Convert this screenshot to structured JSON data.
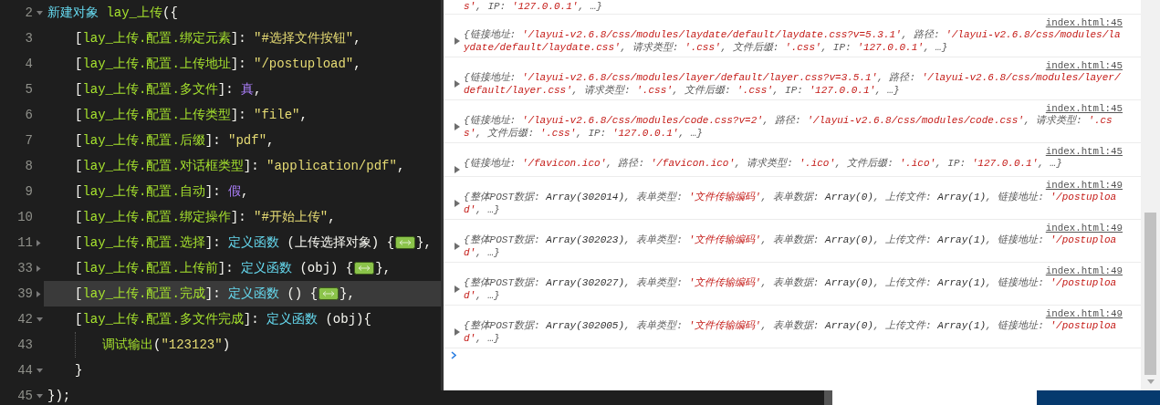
{
  "editor": {
    "lines": [
      {
        "number": "2",
        "folded": false,
        "current": false,
        "tokens": [
          {
            "kind": "keyword",
            "text": "新建对象 "
          },
          {
            "kind": "name",
            "text": "lay_上传"
          },
          {
            "kind": "plain",
            "text": "({"
          }
        ],
        "children": [
          {
            "number": "3",
            "current": false,
            "tokens": [
              {
                "kind": "plain",
                "text": "["
              },
              {
                "kind": "name",
                "text": "lay_上传.配置.绑定元素"
              },
              {
                "kind": "plain",
                "text": "]: "
              },
              {
                "kind": "string",
                "text": "\"#选择文件按钮\""
              },
              {
                "kind": "plain",
                "text": ","
              }
            ]
          },
          {
            "number": "4",
            "current": false,
            "tokens": [
              {
                "kind": "plain",
                "text": "["
              },
              {
                "kind": "name",
                "text": "lay_上传.配置.上传地址"
              },
              {
                "kind": "plain",
                "text": "]: "
              },
              {
                "kind": "string",
                "text": "\"/postupload\""
              },
              {
                "kind": "plain",
                "text": ","
              }
            ]
          },
          {
            "number": "5",
            "current": false,
            "tokens": [
              {
                "kind": "plain",
                "text": "["
              },
              {
                "kind": "name",
                "text": "lay_上传.配置.多文件"
              },
              {
                "kind": "plain",
                "text": "]: "
              },
              {
                "kind": "constant",
                "text": "真"
              },
              {
                "kind": "plain",
                "text": ","
              }
            ]
          },
          {
            "number": "6",
            "current": false,
            "tokens": [
              {
                "kind": "plain",
                "text": "["
              },
              {
                "kind": "name",
                "text": "lay_上传.配置.上传类型"
              },
              {
                "kind": "plain",
                "text": "]: "
              },
              {
                "kind": "string",
                "text": "\"file\""
              },
              {
                "kind": "plain",
                "text": ","
              }
            ]
          },
          {
            "number": "7",
            "current": false,
            "tokens": [
              {
                "kind": "plain",
                "text": "["
              },
              {
                "kind": "name",
                "text": "lay_上传.配置.后缀"
              },
              {
                "kind": "plain",
                "text": "]: "
              },
              {
                "kind": "string",
                "text": "\"pdf\""
              },
              {
                "kind": "plain",
                "text": ","
              }
            ]
          },
          {
            "number": "8",
            "current": false,
            "tokens": [
              {
                "kind": "plain",
                "text": "["
              },
              {
                "kind": "name",
                "text": "lay_上传.配置.对话框类型"
              },
              {
                "kind": "plain",
                "text": "]: "
              },
              {
                "kind": "string",
                "text": "\"application/pdf\""
              },
              {
                "kind": "plain",
                "text": ","
              }
            ]
          },
          {
            "number": "9",
            "current": false,
            "tokens": [
              {
                "kind": "plain",
                "text": "["
              },
              {
                "kind": "name",
                "text": "lay_上传.配置.自动"
              },
              {
                "kind": "plain",
                "text": "]: "
              },
              {
                "kind": "constant",
                "text": "假"
              },
              {
                "kind": "plain",
                "text": ","
              }
            ]
          },
          {
            "number": "10",
            "current": false,
            "tokens": [
              {
                "kind": "plain",
                "text": "["
              },
              {
                "kind": "name",
                "text": "lay_上传.配置.绑定操作"
              },
              {
                "kind": "plain",
                "text": "]: "
              },
              {
                "kind": "string",
                "text": "\"#开始上传\""
              },
              {
                "kind": "plain",
                "text": ","
              }
            ]
          },
          {
            "number": "11",
            "folded": true,
            "current": false,
            "tokens": [
              {
                "kind": "plain",
                "text": "["
              },
              {
                "kind": "name",
                "text": "lay_上传.配置.选择"
              },
              {
                "kind": "plain",
                "text": "]: "
              },
              {
                "kind": "keyword",
                "text": "定义函数"
              },
              {
                "kind": "plain",
                "text": " (上传选择对象) {"
              },
              {
                "kind": "folded"
              },
              {
                "kind": "plain",
                "text": "},"
              }
            ]
          },
          {
            "number": "33",
            "folded": true,
            "current": false,
            "tokens": [
              {
                "kind": "plain",
                "text": "["
              },
              {
                "kind": "name",
                "text": "lay_上传.配置.上传前"
              },
              {
                "kind": "plain",
                "text": "]: "
              },
              {
                "kind": "keyword",
                "text": "定义函数"
              },
              {
                "kind": "plain",
                "text": " (obj) {"
              },
              {
                "kind": "folded"
              },
              {
                "kind": "plain",
                "text": "},"
              }
            ]
          },
          {
            "number": "39",
            "folded": true,
            "current": true,
            "tokens": [
              {
                "kind": "plain",
                "text": "["
              },
              {
                "kind": "name",
                "text": "lay_上传.配置.完成"
              },
              {
                "kind": "plain",
                "text": "]: "
              },
              {
                "kind": "keyword",
                "text": "定义函数"
              },
              {
                "kind": "plain",
                "text": " () {"
              },
              {
                "kind": "folded"
              },
              {
                "kind": "plain",
                "text": "},"
              }
            ]
          },
          {
            "number": "42",
            "folded": false,
            "current": false,
            "tokens": [
              {
                "kind": "plain",
                "text": "["
              },
              {
                "kind": "name",
                "text": "lay_上传.配置.多文件完成"
              },
              {
                "kind": "plain",
                "text": "]: "
              },
              {
                "kind": "keyword",
                "text": "定义函数"
              },
              {
                "kind": "plain",
                "text": " (obj){"
              }
            ],
            "children": [
              {
                "number": "43",
                "current": false,
                "tokens": [
                  {
                    "kind": "name",
                    "text": "调试输出"
                  },
                  {
                    "kind": "plain",
                    "text": "("
                  },
                  {
                    "kind": "string",
                    "text": "\"123123\""
                  },
                  {
                    "kind": "plain",
                    "text": ")"
                  }
                ]
              }
            ]
          },
          {
            "number": "44",
            "folded": false,
            "current": false,
            "tokens": [
              {
                "kind": "plain",
                "text": "}"
              }
            ]
          }
        ]
      },
      {
        "number": "45",
        "folded": false,
        "current": false,
        "tokens": [
          {
            "kind": "plain",
            "text": "});"
          }
        ]
      }
    ]
  },
  "console": {
    "entries": [
      {
        "segments": [
          {
            "kind": "string",
            "text": "s'"
          },
          {
            "kind": "key",
            "text": ", IP: "
          },
          {
            "kind": "string",
            "text": "'127.0.0.1'"
          },
          {
            "kind": "key",
            "text": ", …}"
          }
        ]
      },
      {
        "source": "index.html:45",
        "segments": [
          {
            "kind": "key",
            "text": "{链接地址: "
          },
          {
            "kind": "string",
            "text": "'/layui-v2.6.8/css/modules/laydate/default/laydate.css?v=5.3.1'"
          },
          {
            "kind": "key",
            "text": ", 路径: "
          },
          {
            "kind": "string",
            "text": "'/layui-v2.6.8/css/modules/laydate/default/laydate.css'"
          },
          {
            "kind": "key",
            "text": ", 请求类型: "
          },
          {
            "kind": "string",
            "text": "'.css'"
          },
          {
            "kind": "key",
            "text": ", 文件后缀: "
          },
          {
            "kind": "string",
            "text": "'.css'"
          },
          {
            "kind": "key",
            "text": ", IP: "
          },
          {
            "kind": "string",
            "text": "'127.0.0.1'"
          },
          {
            "kind": "key",
            "text": ", …}"
          }
        ]
      },
      {
        "source": "index.html:45",
        "segments": [
          {
            "kind": "key",
            "text": "{链接地址: "
          },
          {
            "kind": "string",
            "text": "'/layui-v2.6.8/css/modules/layer/default/layer.css?v=3.5.1'"
          },
          {
            "kind": "key",
            "text": ", 路径: "
          },
          {
            "kind": "string",
            "text": "'/layui-v2.6.8/css/modules/layer/default/layer.css'"
          },
          {
            "kind": "key",
            "text": ", 请求类型: "
          },
          {
            "kind": "string",
            "text": "'.css'"
          },
          {
            "kind": "key",
            "text": ", 文件后缀: "
          },
          {
            "kind": "string",
            "text": "'.css'"
          },
          {
            "kind": "key",
            "text": ", IP: "
          },
          {
            "kind": "string",
            "text": "'127.0.0.1'"
          },
          {
            "kind": "key",
            "text": ", …}"
          }
        ]
      },
      {
        "source": "index.html:45",
        "segments": [
          {
            "kind": "key",
            "text": "{链接地址: "
          },
          {
            "kind": "string",
            "text": "'/layui-v2.6.8/css/modules/code.css?v=2'"
          },
          {
            "kind": "key",
            "text": ", 路径: "
          },
          {
            "kind": "string",
            "text": "'/layui-v2.6.8/css/modules/code.css'"
          },
          {
            "kind": "key",
            "text": ", 请求类型: "
          },
          {
            "kind": "string",
            "text": "'.css'"
          },
          {
            "kind": "key",
            "text": ", 文件后缀: "
          },
          {
            "kind": "string",
            "text": "'.css'"
          },
          {
            "kind": "key",
            "text": ", IP: "
          },
          {
            "kind": "string",
            "text": "'127.0.0.1'"
          },
          {
            "kind": "key",
            "text": ", …}"
          }
        ]
      },
      {
        "source": "index.html:45",
        "segments": [
          {
            "kind": "key",
            "text": "{链接地址: "
          },
          {
            "kind": "string",
            "text": "'/favicon.ico'"
          },
          {
            "kind": "key",
            "text": ", 路径: "
          },
          {
            "kind": "string",
            "text": "'/favicon.ico'"
          },
          {
            "kind": "key",
            "text": ", 请求类型: "
          },
          {
            "kind": "string",
            "text": "'.ico'"
          },
          {
            "kind": "key",
            "text": ", 文件后缀: "
          },
          {
            "kind": "string",
            "text": "'.ico'"
          },
          {
            "kind": "key",
            "text": ", IP: "
          },
          {
            "kind": "string",
            "text": "'127.0.0.1'"
          },
          {
            "kind": "key",
            "text": ", …}"
          }
        ]
      },
      {
        "source": "index.html:49",
        "segments": [
          {
            "kind": "key",
            "text": "{整体POST数据: "
          },
          {
            "kind": "value",
            "text": "Array(302014)"
          },
          {
            "kind": "key",
            "text": ", 表单类型: "
          },
          {
            "kind": "string",
            "text": "'文件传输编码'"
          },
          {
            "kind": "key",
            "text": ", 表单数据: "
          },
          {
            "kind": "value",
            "text": "Array(0)"
          },
          {
            "kind": "key",
            "text": ", 上传文件: "
          },
          {
            "kind": "value",
            "text": "Array(1)"
          },
          {
            "kind": "key",
            "text": ", 链接地址: "
          },
          {
            "kind": "string",
            "text": "'/postupload'"
          },
          {
            "kind": "key",
            "text": ", …}"
          }
        ]
      },
      {
        "source": "index.html:49",
        "segments": [
          {
            "kind": "key",
            "text": "{整体POST数据: "
          },
          {
            "kind": "value",
            "text": "Array(302023)"
          },
          {
            "kind": "key",
            "text": ", 表单类型: "
          },
          {
            "kind": "string",
            "text": "'文件传输编码'"
          },
          {
            "kind": "key",
            "text": ", 表单数据: "
          },
          {
            "kind": "value",
            "text": "Array(0)"
          },
          {
            "kind": "key",
            "text": ", 上传文件: "
          },
          {
            "kind": "value",
            "text": "Array(1)"
          },
          {
            "kind": "key",
            "text": ", 链接地址: "
          },
          {
            "kind": "string",
            "text": "'/postupload'"
          },
          {
            "kind": "key",
            "text": ", …}"
          }
        ]
      },
      {
        "source": "index.html:49",
        "segments": [
          {
            "kind": "key",
            "text": "{整体POST数据: "
          },
          {
            "kind": "value",
            "text": "Array(302027)"
          },
          {
            "kind": "key",
            "text": ", 表单类型: "
          },
          {
            "kind": "string",
            "text": "'文件传输编码'"
          },
          {
            "kind": "key",
            "text": ", 表单数据: "
          },
          {
            "kind": "value",
            "text": "Array(0)"
          },
          {
            "kind": "key",
            "text": ", 上传文件: "
          },
          {
            "kind": "value",
            "text": "Array(1)"
          },
          {
            "kind": "key",
            "text": ", 链接地址: "
          },
          {
            "kind": "string",
            "text": "'/postupload'"
          },
          {
            "kind": "key",
            "text": ", …}"
          }
        ]
      },
      {
        "source": "index.html:49",
        "segments": [
          {
            "kind": "key",
            "text": "{整体POST数据: "
          },
          {
            "kind": "value",
            "text": "Array(302005)"
          },
          {
            "kind": "key",
            "text": ", 表单类型: "
          },
          {
            "kind": "string",
            "text": "'文件传输编码'"
          },
          {
            "kind": "key",
            "text": ", 表单数据: "
          },
          {
            "kind": "value",
            "text": "Array(0)"
          },
          {
            "kind": "key",
            "text": ", 上传文件: "
          },
          {
            "kind": "value",
            "text": "Array(1)"
          },
          {
            "kind": "key",
            "text": ", 链接地址: "
          },
          {
            "kind": "string",
            "text": "'/postupload'"
          },
          {
            "kind": "key",
            "text": ", …}"
          }
        ]
      }
    ]
  }
}
